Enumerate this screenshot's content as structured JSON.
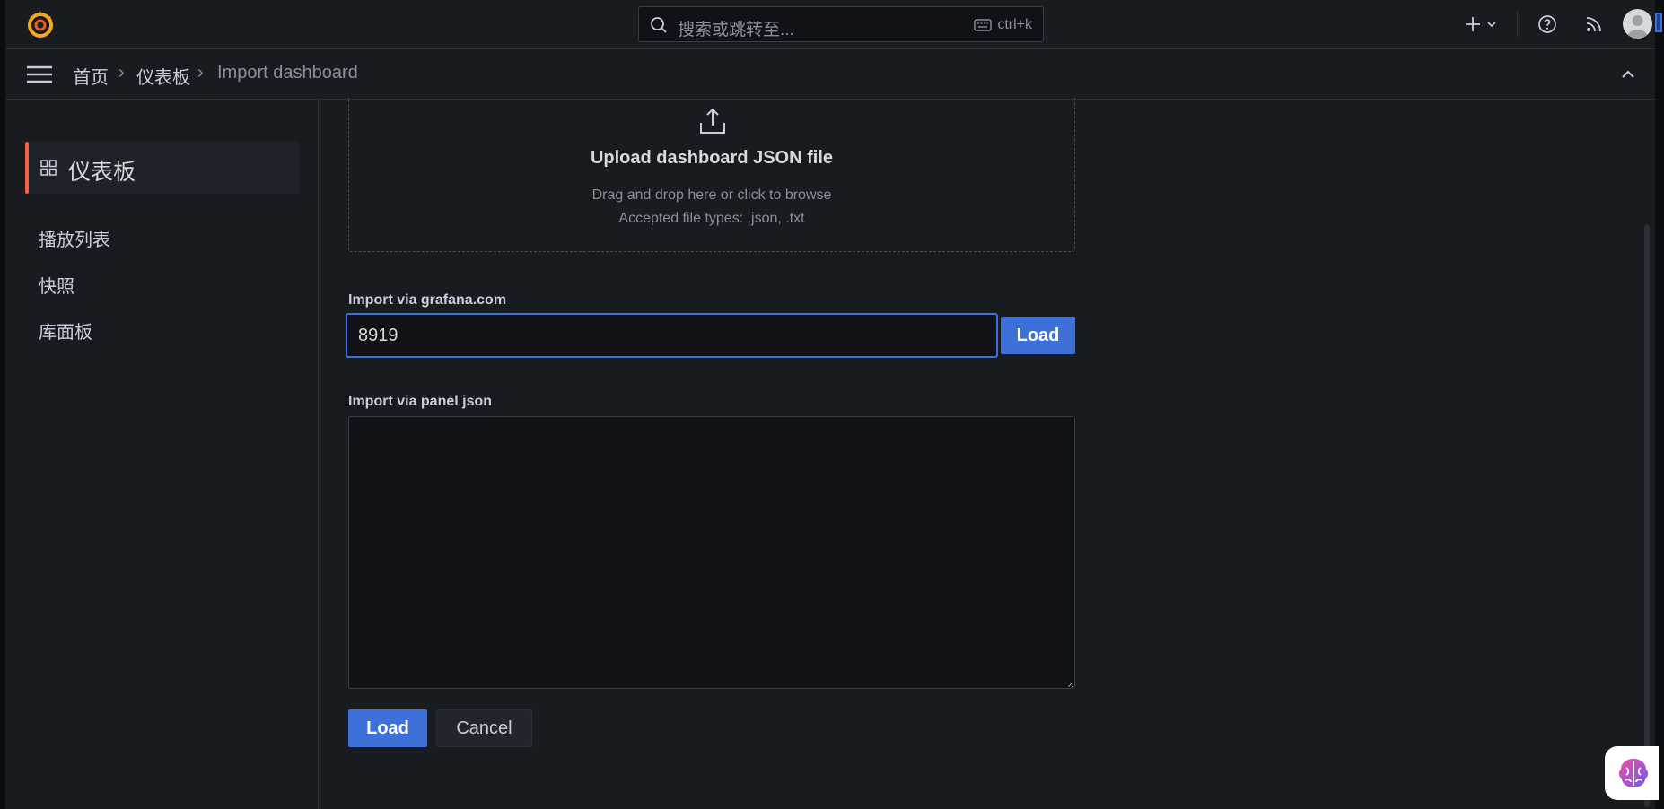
{
  "topbar": {
    "search_placeholder": "搜索或跳转至...",
    "search_shortcut": "ctrl+k"
  },
  "breadcrumb": {
    "home": "首页",
    "section": "仪表板",
    "current": "Import dashboard",
    "separator": "›"
  },
  "sidebar": {
    "active_label": "仪表板",
    "items": [
      "播放列表",
      "快照",
      "库面板"
    ]
  },
  "upload": {
    "title": "Upload dashboard JSON file",
    "hint_line1": "Drag and drop here or click to browse",
    "hint_line2": "Accepted file types: .json, .txt"
  },
  "grafana_import": {
    "label": "Import via grafana.com",
    "value": "8919",
    "load_label": "Load"
  },
  "panel_json": {
    "label": "Import via panel json",
    "value": ""
  },
  "actions": {
    "load_label": "Load",
    "cancel_label": "Cancel"
  },
  "colors": {
    "accent": "#3d71d9",
    "active_marker": "#f55f3e",
    "background": "#181b1f"
  }
}
